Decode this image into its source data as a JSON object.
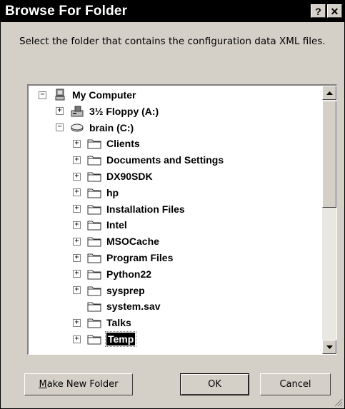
{
  "window": {
    "title": "Browse For Folder",
    "help_label": "?",
    "close_label": "✕"
  },
  "instruction": "Select the folder that contains the configuration data XML files.",
  "tree": {
    "items": [
      {
        "label": "My Computer",
        "expander": "−",
        "icon": "computer-icon",
        "level": 0
      },
      {
        "label": "3½ Floppy (A:)",
        "expander": "+",
        "icon": "floppy-drive-icon",
        "level": 1
      },
      {
        "label": "brain (C:)",
        "expander": "−",
        "icon": "hard-drive-icon",
        "level": 1
      },
      {
        "label": "Clients",
        "expander": "+",
        "icon": "folder-icon",
        "level": 2
      },
      {
        "label": "Documents and Settings",
        "expander": "+",
        "icon": "folder-icon",
        "level": 2
      },
      {
        "label": "DX90SDK",
        "expander": "+",
        "icon": "folder-icon",
        "level": 2
      },
      {
        "label": "hp",
        "expander": "+",
        "icon": "folder-icon",
        "level": 2
      },
      {
        "label": "Installation Files",
        "expander": "+",
        "icon": "folder-icon",
        "level": 2
      },
      {
        "label": "Intel",
        "expander": "+",
        "icon": "folder-icon",
        "level": 2
      },
      {
        "label": "MSOCache",
        "expander": "+",
        "icon": "folder-icon",
        "level": 2
      },
      {
        "label": "Program Files",
        "expander": "+",
        "icon": "folder-icon",
        "level": 2
      },
      {
        "label": "Python22",
        "expander": "+",
        "icon": "folder-icon",
        "level": 2
      },
      {
        "label": "sysprep",
        "expander": "+",
        "icon": "folder-icon",
        "level": 2
      },
      {
        "label": "system.sav",
        "expander": "",
        "icon": "folder-icon",
        "level": 2
      },
      {
        "label": "Talks",
        "expander": "+",
        "icon": "folder-icon",
        "level": 2
      },
      {
        "label": "Temp",
        "expander": "+",
        "icon": "folder-icon",
        "level": 2,
        "selected": true
      }
    ]
  },
  "buttons": {
    "make_new_folder_mnemonic": "M",
    "make_new_folder_rest": "ake New Folder",
    "ok": "OK",
    "cancel": "Cancel"
  },
  "colors": {
    "face": "#d4d0c8",
    "titlebar": "#000000",
    "selection": "#000000"
  }
}
